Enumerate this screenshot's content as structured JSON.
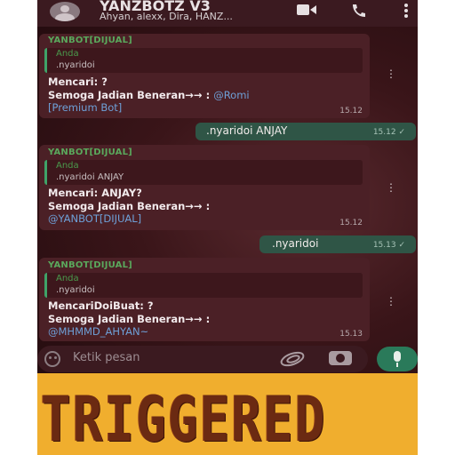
{
  "header": {
    "title": "YANZBOTZ V3",
    "subtitle": "Ahyan, alexx, Dira, HANZ...",
    "video_icon": "video-call-icon",
    "call_icon": "phone-icon",
    "menu_icon": "more-vert-icon"
  },
  "messages": [
    {
      "sender": "YANBOT[DIJUAL]",
      "quote_name": "Anda",
      "quote_text": ".nyaridoi",
      "line1": "Mencari: ?",
      "line2_prefix": "Semoga Jadian Beneran→→ : ",
      "line2_mention": "@Romi",
      "line3_mention": "[Premium Bot]",
      "time": "15.12"
    },
    {
      "outgoing": true,
      "text": ".nyaridoi ANJAY",
      "time": "15.12 ✓"
    },
    {
      "sender": "YANBOT[DIJUAL]",
      "quote_name": "Anda",
      "quote_text": ".nyaridoi ANJAY",
      "line1": "Mencari: ANJAY?",
      "line2_prefix": "Semoga Jadian Beneran→→ :",
      "line3_mention": "@YANBOT[DIJUAL]",
      "time": "15.12"
    },
    {
      "outgoing": true,
      "text": ".nyaridoi",
      "time": "15.13 ✓"
    },
    {
      "sender": "YANBOT[DIJUAL]",
      "quote_name": "Anda",
      "quote_text": ".nyaridoi",
      "line1": "MencariDoiBuat: ?",
      "line2_prefix": "Semoga Jadian Beneran→→ :",
      "line3_mention": "@MHMMD_AHYAN~",
      "time": "15.13"
    }
  ],
  "input": {
    "placeholder": "Ketik pesan",
    "emoji_icon": "emoji-icon",
    "attach_icon": "attach-icon",
    "camera_icon": "camera-icon",
    "mic_icon": "mic-icon"
  },
  "banner": {
    "text": "TRIGGERED"
  },
  "colors": {
    "sender": "#5aa85c",
    "mention": "#6ea0d8",
    "outgoing_bubble": "#2f5546",
    "incoming_bubble": "#4b2026",
    "banner_bg": "#f0ae2e",
    "banner_text": "#6b2a12"
  }
}
